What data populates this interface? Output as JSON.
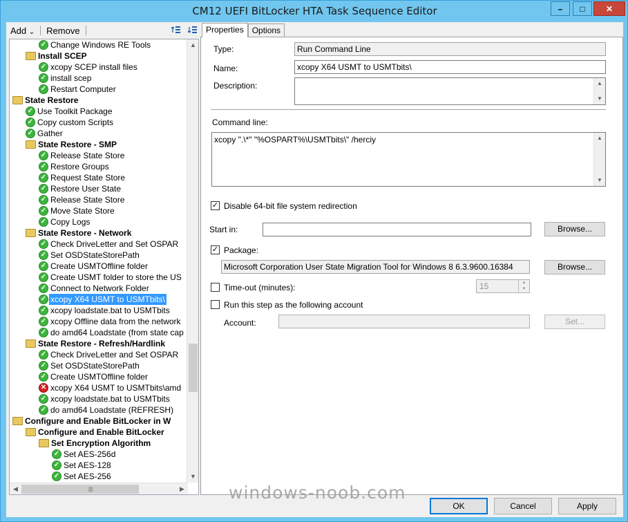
{
  "window": {
    "title": "CM12 UEFI BitLocker HTA Task Sequence Editor",
    "minimize_glyph": "–",
    "maximize_glyph": "□",
    "close_glyph": "✕"
  },
  "left_toolbar": {
    "add_label": "Add",
    "add_arrow": "⌄",
    "remove_label": "Remove",
    "icons": [
      "move-up-icon",
      "move-down-icon"
    ]
  },
  "tree": {
    "rows": [
      {
        "label": "Change Windows RE Tools",
        "indent": 3,
        "type": "ok"
      },
      {
        "label": "Install SCEP",
        "indent": 2,
        "type": "folder"
      },
      {
        "label": "xcopy SCEP install files",
        "indent": 3,
        "type": "ok"
      },
      {
        "label": "install scep",
        "indent": 3,
        "type": "ok"
      },
      {
        "label": "Restart Computer",
        "indent": 3,
        "type": "ok"
      },
      {
        "label": "State Restore",
        "indent": 1,
        "type": "folder"
      },
      {
        "label": "Use Toolkit Package",
        "indent": 2,
        "type": "ok"
      },
      {
        "label": "Copy custom Scripts",
        "indent": 2,
        "type": "ok"
      },
      {
        "label": "Gather",
        "indent": 2,
        "type": "ok"
      },
      {
        "label": "State Restore - SMP",
        "indent": 2,
        "type": "folder"
      },
      {
        "label": "Release State Store",
        "indent": 3,
        "type": "ok"
      },
      {
        "label": "Restore Groups",
        "indent": 3,
        "type": "ok"
      },
      {
        "label": "Request State Store",
        "indent": 3,
        "type": "ok"
      },
      {
        "label": "Restore User State",
        "indent": 3,
        "type": "ok"
      },
      {
        "label": "Release State Store",
        "indent": 3,
        "type": "ok"
      },
      {
        "label": "Move State Store",
        "indent": 3,
        "type": "ok"
      },
      {
        "label": "Copy Logs",
        "indent": 3,
        "type": "ok"
      },
      {
        "label": "State Restore - Network",
        "indent": 2,
        "type": "folder"
      },
      {
        "label": "Check DriveLetter and Set OSPAR",
        "indent": 3,
        "type": "ok"
      },
      {
        "label": "Set OSDStateStorePath",
        "indent": 3,
        "type": "ok"
      },
      {
        "label": "Create USMTOffline folder",
        "indent": 3,
        "type": "ok"
      },
      {
        "label": "Create USMT folder to store the US",
        "indent": 3,
        "type": "ok"
      },
      {
        "label": "Connect to Network Folder",
        "indent": 3,
        "type": "ok"
      },
      {
        "label": "xcopy X64 USMT to USMTbits\\",
        "indent": 3,
        "type": "ok",
        "selected": true
      },
      {
        "label": "xcopy loadstate.bat to USMTbits",
        "indent": 3,
        "type": "ok"
      },
      {
        "label": "xcopy Offline data from the network",
        "indent": 3,
        "type": "ok"
      },
      {
        "label": "do amd64 Loadstate (from state cap",
        "indent": 3,
        "type": "ok"
      },
      {
        "label": "State Restore - Refresh/Hardlink",
        "indent": 2,
        "type": "folder"
      },
      {
        "label": "Check DriveLetter and Set OSPAR",
        "indent": 3,
        "type": "ok"
      },
      {
        "label": "Set OSDStateStorePath",
        "indent": 3,
        "type": "ok"
      },
      {
        "label": "Create USMTOffline folder",
        "indent": 3,
        "type": "ok"
      },
      {
        "label": "xcopy X64 USMT to USMTbits\\amd",
        "indent": 3,
        "type": "err"
      },
      {
        "label": "xcopy loadstate.bat to USMTbits",
        "indent": 3,
        "type": "ok"
      },
      {
        "label": "do amd64 Loadstate (REFRESH)",
        "indent": 3,
        "type": "ok"
      },
      {
        "label": "Configure and Enable BitLocker in W",
        "indent": 1,
        "type": "folder"
      },
      {
        "label": "Configure and Enable BitLocker",
        "indent": 2,
        "type": "folder"
      },
      {
        "label": "Set Encryption Algorithm",
        "indent": 3,
        "type": "folder"
      },
      {
        "label": "Set AES-256d",
        "indent": 4,
        "type": "ok"
      },
      {
        "label": "Set AES-128",
        "indent": 4,
        "type": "ok"
      },
      {
        "label": "Set AES-256",
        "indent": 4,
        "type": "ok"
      }
    ]
  },
  "tabs": [
    {
      "label": "Properties",
      "active": true
    },
    {
      "label": "Options",
      "active": false
    }
  ],
  "properties": {
    "type_label": "Type:",
    "type_value": "Run Command Line",
    "name_label": "Name:",
    "name_value": "xcopy X64 USMT to USMTbits\\",
    "description_label": "Description:",
    "description_value": "",
    "command_line_label": "Command line:",
    "command_line_value": "xcopy \".\\*\" \"%OSPART%\\USMTbits\\\" /herciy",
    "disable64_label": "Disable 64-bit file system redirection",
    "disable64_checked": true,
    "start_in_label": "Start in:",
    "start_in_value": "",
    "browse_label": "Browse...",
    "package_label": "Package:",
    "package_checked": true,
    "package_value": "Microsoft Corporation User State Migration Tool for Windows 8 6.3.9600.16384",
    "timeout_label": "Time-out (minutes):",
    "timeout_checked": false,
    "timeout_value": "15",
    "run_as_label": "Run this step as the following account",
    "run_as_checked": false,
    "account_label": "Account:",
    "account_value": "",
    "set_label": "Set..."
  },
  "footer": {
    "ok_label": "OK",
    "cancel_label": "Cancel",
    "apply_label": "Apply"
  },
  "watermark": "windows-noob.com"
}
